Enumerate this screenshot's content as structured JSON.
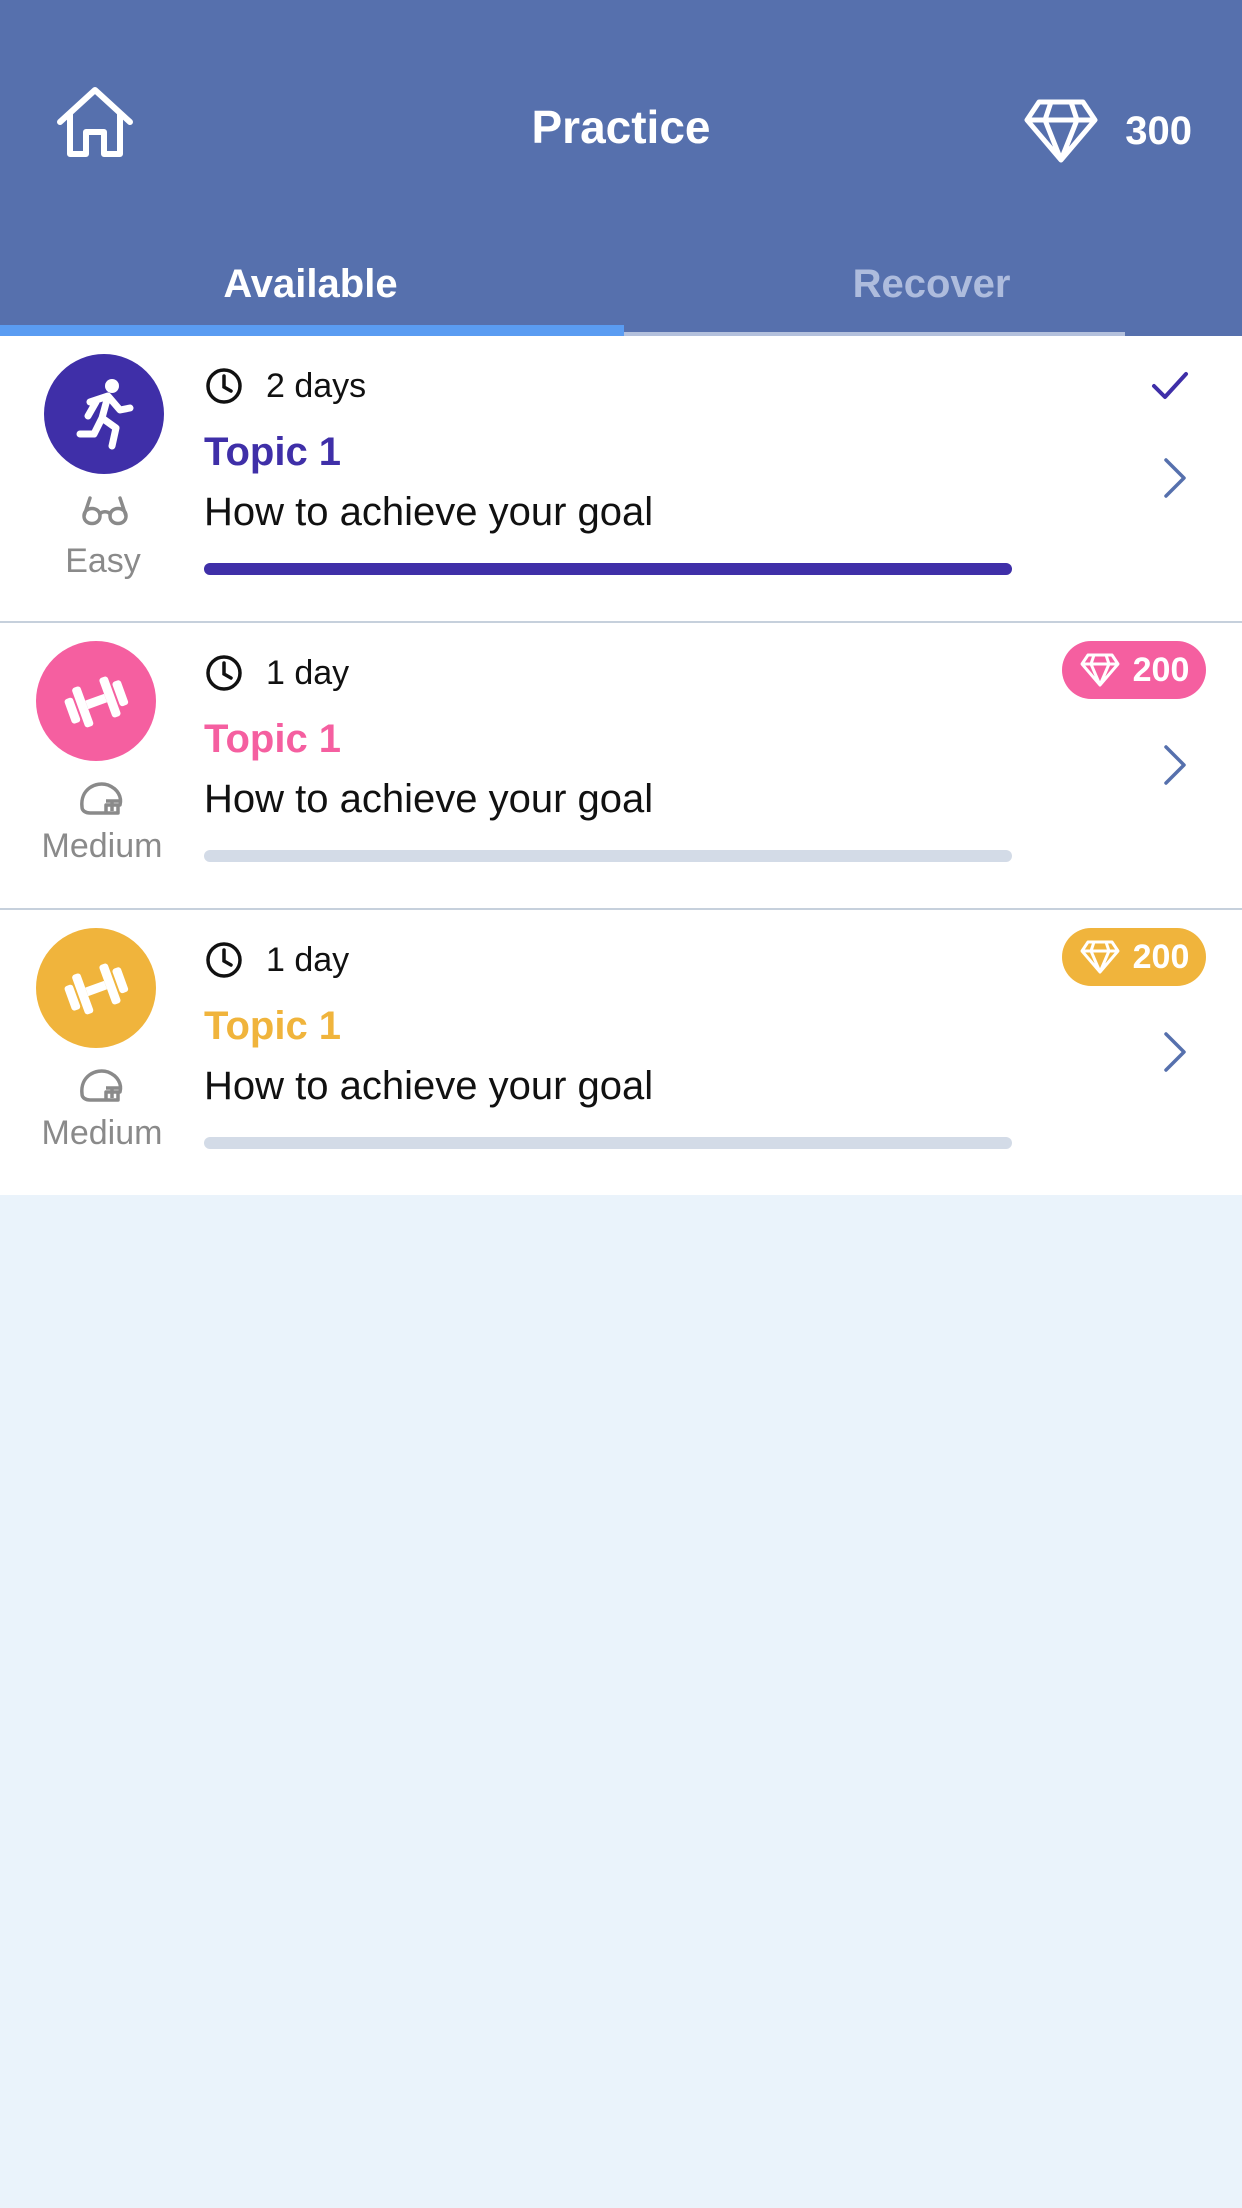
{
  "header": {
    "title": "Practice",
    "gems": "300",
    "background": "#5670ad"
  },
  "tabs": [
    {
      "label": "Available",
      "active": true
    },
    {
      "label": "Recover",
      "active": false
    }
  ],
  "cards": [
    {
      "icon": "running-person-icon",
      "color": "#3f2fa8",
      "level": "Easy",
      "level_icon": "glasses-icon",
      "time": "2 days",
      "topic": "Topic 1",
      "description": "How to achieve your goal",
      "progress": 1.0,
      "completed": true
    },
    {
      "icon": "dumbbell-icon",
      "color": "#f55fa0",
      "level": "Medium",
      "level_icon": "helmet-icon",
      "time": "1 day",
      "topic": "Topic 1",
      "description": "How to achieve your goal",
      "progress": 0,
      "reward": "200"
    },
    {
      "icon": "dumbbell-icon",
      "color": "#f0b43c",
      "level": "Medium",
      "level_icon": "helmet-icon",
      "time": "1 day",
      "topic": "Topic 1",
      "description": "How to achieve your goal",
      "progress": 0,
      "reward": "200"
    }
  ]
}
